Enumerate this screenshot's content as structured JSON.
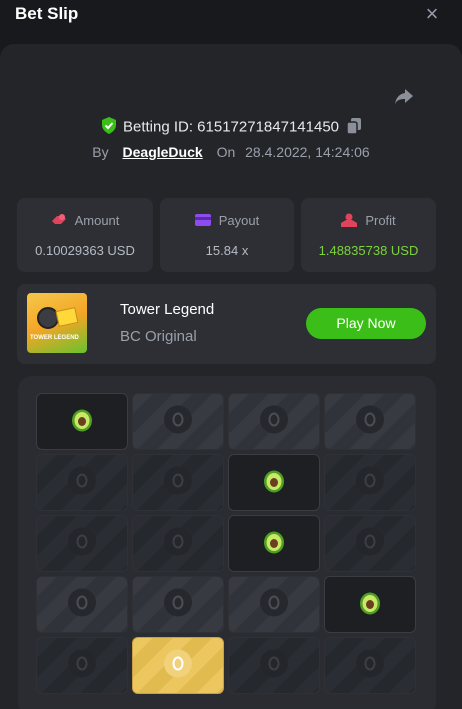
{
  "header": {
    "title": "Bet Slip",
    "close_label": "×"
  },
  "bet": {
    "id_text": "Betting ID: 61517271847141450",
    "by_label": "By",
    "user": "DeagleDuck",
    "on_label": "On",
    "date": "28.4.2022, 14:24:06"
  },
  "stats": {
    "amount_label": "Amount",
    "amount_value": "0.10029363 USD",
    "payout_label": "Payout",
    "payout_value": "15.84 x",
    "profit_label": "Profit",
    "profit_value": "1.48835738 USD"
  },
  "game": {
    "name": "Tower Legend",
    "subtitle": "BC Original",
    "thumb_text": "TOWER LEGEND",
    "play_label": "Play Now"
  },
  "colors": {
    "accent_green": "#3bbf18",
    "profit_green": "#7bd43a",
    "gold_tile": "#ecc760",
    "avocado": "#79c23a"
  },
  "icons": [
    "share-icon",
    "shield-check-icon",
    "copy-icon",
    "amount-icon",
    "payout-icon",
    "profit-icon",
    "avocado-icon",
    "egg-icon"
  ],
  "grid": {
    "columns": 4,
    "rows": [
      [
        "avocado-revealed",
        "egg-hidden",
        "egg-hidden",
        "egg-hidden"
      ],
      [
        "egg-dim",
        "egg-dim",
        "avocado-revealed",
        "egg-dim"
      ],
      [
        "egg-dim",
        "egg-dim",
        "avocado-revealed",
        "egg-dim"
      ],
      [
        "egg-hidden",
        "egg-hidden",
        "egg-hidden",
        "avocado-revealed"
      ],
      [
        "egg-dim",
        "egg-gold",
        "egg-dim",
        "egg-dim"
      ]
    ]
  }
}
